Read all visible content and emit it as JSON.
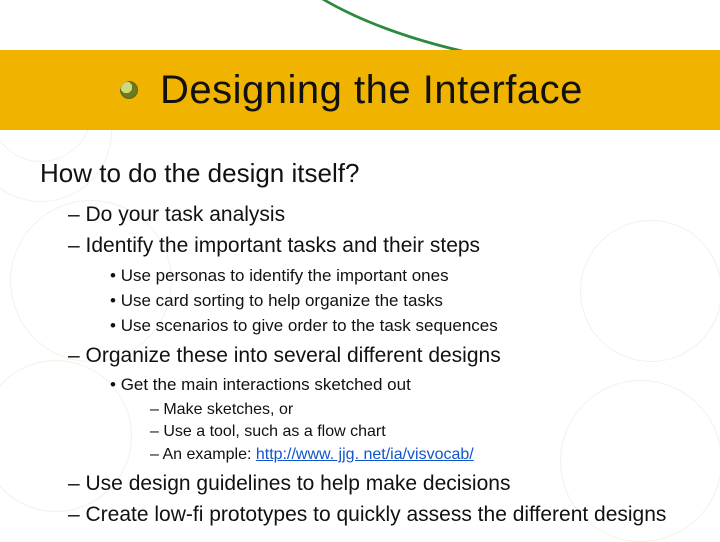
{
  "title": "Designing the Interface",
  "heading": "How to do the design itself?",
  "bullets": {
    "b1": "Do your task analysis",
    "b2": "Identify the important tasks and their steps",
    "b2_sub": {
      "s1": "Use personas to identify the important ones",
      "s2": "Use card sorting to help organize the tasks",
      "s3": "Use scenarios to give order to the task sequences"
    },
    "b3": "Organize these into several different designs",
    "b3_sub": {
      "s1": "Get the main interactions sketched out",
      "s1_sub": {
        "t1": "Make sketches, or",
        "t2": "Use a tool, such as a flow chart",
        "t3_prefix": "An example: ",
        "t3_link": "http://www. jjg. net/ia/visvocab/"
      }
    },
    "b4": "Use design guidelines to help make decisions",
    "b5": "Create low-fi prototypes to quickly assess the different designs"
  },
  "link_href": "http://www.jjg.net/ia/visvocab/"
}
